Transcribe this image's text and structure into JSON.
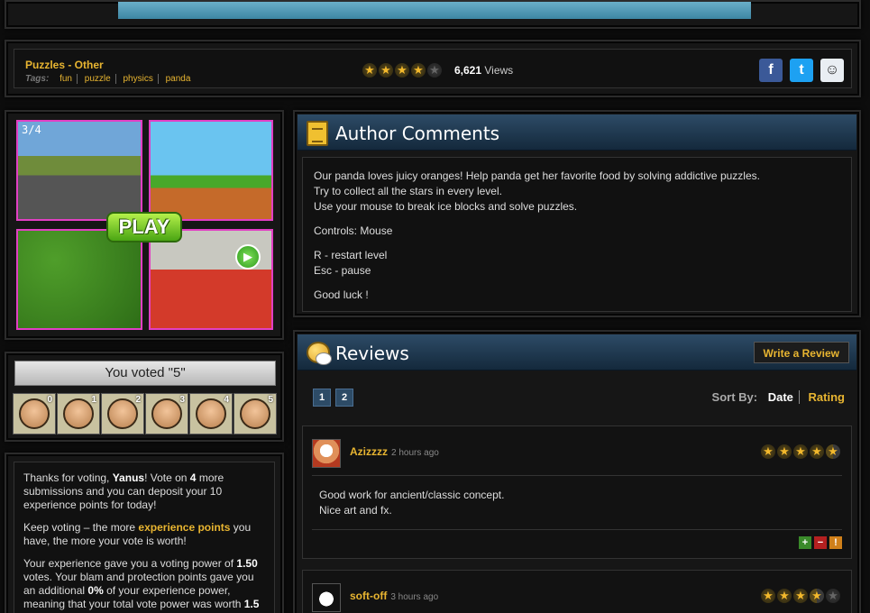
{
  "info_bar": {
    "genre": "Puzzles - Other",
    "tags_label": "Tags:",
    "tags": [
      "fun",
      "puzzle",
      "physics",
      "panda"
    ],
    "rating_stars": 4,
    "views_count": "6,621",
    "views_label": "Views"
  },
  "thumbnail": {
    "t1_label": "3/4",
    "play_label": "PLAY"
  },
  "vote": {
    "voted_text": "You voted \"5\"",
    "faces": [
      "0",
      "1",
      "2",
      "3",
      "4",
      "5"
    ]
  },
  "thanks": {
    "p1_a": "Thanks for voting, ",
    "p1_user": "Yanus",
    "p1_b": "! Vote on ",
    "p1_count": "4",
    "p1_c": " more submissions and you can deposit your 10 experience points for today!",
    "p2_a": "Keep voting – the more ",
    "p2_hl": "experience points",
    "p2_b": " you have, the more your vote is worth!",
    "p3_a": "Your experience gave you a voting power of ",
    "p3_power": "1.50",
    "p3_b": " votes. Your blam and protection points gave you an additional ",
    "p3_pct": "0%",
    "p3_c": " of your experience power, meaning that your total vote power was worth ",
    "p3_total": "1.5"
  },
  "author": {
    "title": "Author Comments",
    "lines": [
      "Our panda loves juicy oranges! Help panda get her favorite food by solving addictive puzzles.",
      "Try to collect all the stars in every level.",
      "Use your mouse to break ice blocks and solve puzzles.",
      "Controls: Mouse",
      "R - restart level",
      "Esc - pause",
      "Good luck !"
    ]
  },
  "reviews": {
    "title": "Reviews",
    "write_label": "Write a Review",
    "pages": [
      "1",
      "2"
    ],
    "sort_label": "Sort By:",
    "sort_date": "Date",
    "sort_rating": "Rating",
    "items": [
      {
        "user": "Azizzzz",
        "time": "2 hours ago",
        "stars": 4.5,
        "text": [
          "Good work for ancient/classic concept.",
          "Nice art and fx."
        ]
      },
      {
        "user": "soft-off",
        "time": "3 hours ago",
        "stars": 3.5,
        "text": []
      }
    ]
  },
  "colors": {
    "accent": "#e8b531",
    "header_blue": "#2d4b66"
  }
}
